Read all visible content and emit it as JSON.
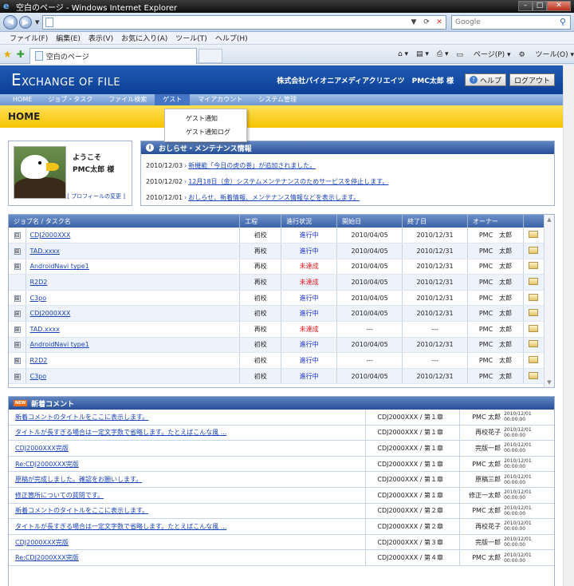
{
  "browser": {
    "title": "空白のページ - Windows Internet Explorer",
    "url": "",
    "search_placeholder": "Google",
    "menu": [
      "ファイル(F)",
      "編集(E)",
      "表示(V)",
      "お気に入り(A)",
      "ツール(T)",
      "ヘルプ(H)"
    ],
    "tab_label": "空白のページ",
    "commands": {
      "page": "ページ(P)",
      "tools": "ツール(O)"
    }
  },
  "app": {
    "logo_first": "E",
    "logo_rest": "XCHANGE OF FILE",
    "company": "株式会社パイオニアメディアクリエイツ　PMC太郎 様",
    "help_label": "ヘルプ",
    "logout_label": "ログアウト",
    "nav": [
      "HOME",
      "ジョブ・タスク",
      "ファイル検索",
      "ゲスト",
      "マイアカウント",
      "システム管理"
    ],
    "guest_menu": [
      "ゲスト通知",
      "ゲスト通知ログ"
    ],
    "page_title": "HOME"
  },
  "profile": {
    "greeting": "ようこそ",
    "name": "PMC太郎 様",
    "change_link": "[ プロフィールの変更 ]"
  },
  "news": {
    "title": "おしらせ・メンテナンス情報",
    "items": [
      {
        "date": "2010/12/03",
        "text": "新機能「今日の虎の巻」が追加されました。"
      },
      {
        "date": "2010/12/02",
        "text": "12月18日（金）システムメンテナンスのためサービスを停止します。"
      },
      {
        "date": "2010/12/01",
        "text": "おしらせ、新着情報、メンテナンス情報などを表示します。"
      }
    ]
  },
  "jobs": {
    "headers": [
      "ジョブ名 / タスク名",
      "工程",
      "進行状況",
      "開始日",
      "終了日",
      "オーナー"
    ],
    "rows": [
      {
        "exp": "⊟",
        "name": "CDJ2000XXX",
        "step": "初校",
        "status": "進行中",
        "state": "active",
        "start": "2010/04/05",
        "end": "2010/12/31",
        "owner": "PMC　太郎"
      },
      {
        "exp": "⊞",
        "name": "TAD.xxxx",
        "step": "再校",
        "status": "進行中",
        "state": "active",
        "start": "2010/04/05",
        "end": "2010/12/31",
        "owner": "PMC　太郎"
      },
      {
        "exp": "⊞",
        "name": "AndroidNavi type1",
        "step": "再校",
        "status": "未達成",
        "state": "pending",
        "start": "2010/04/05",
        "end": "2010/12/31",
        "owner": "PMC　太郎"
      },
      {
        "exp": "",
        "name": "R2D2",
        "step": "再校",
        "status": "未達成",
        "state": "pending",
        "start": "2010/04/05",
        "end": "2010/12/31",
        "owner": "PMC　太郎"
      },
      {
        "exp": "⊞",
        "name": "C3po",
        "step": "初校",
        "status": "進行中",
        "state": "active",
        "start": "2010/04/05",
        "end": "2010/12/31",
        "owner": "PMC　太郎"
      },
      {
        "exp": "⊞",
        "name": "CDJ2000XXX",
        "step": "初校",
        "status": "進行中",
        "state": "active",
        "start": "2010/04/05",
        "end": "2010/12/31",
        "owner": "PMC　太郎"
      },
      {
        "exp": "⊞",
        "name": "TAD.xxxx",
        "step": "再校",
        "status": "未達成",
        "state": "pending",
        "start": "---",
        "end": "---",
        "owner": "PMC　太郎"
      },
      {
        "exp": "⊞",
        "name": "AndroidNavi type1",
        "step": "初校",
        "status": "進行中",
        "state": "active",
        "start": "2010/04/05",
        "end": "2010/12/31",
        "owner": "PMC　太郎"
      },
      {
        "exp": "⊞",
        "name": "R2D2",
        "step": "初校",
        "status": "進行中",
        "state": "active",
        "start": "---",
        "end": "---",
        "owner": "PMC　太郎"
      },
      {
        "exp": "⊞",
        "name": "C3po",
        "step": "初校",
        "status": "進行中",
        "state": "active",
        "start": "2010/04/05",
        "end": "2010/12/31",
        "owner": "PMC　太郎"
      }
    ]
  },
  "comments": {
    "title": "新着コメント",
    "badge": "NEW",
    "rows": [
      {
        "title": "新着コメントのタイトルをここに表示します。",
        "job": "CDJ2000XXX / 第１章",
        "user": "PMC 太郎",
        "date": "2010/12/01 00:00:00"
      },
      {
        "title": "タイトルが長すぎる場合は一定文字数で省略します。たとえばこんな風 ...",
        "job": "CDJ2000XXX / 第１章",
        "user": "再校花子",
        "date": "2010/12/01 00:00:00"
      },
      {
        "title": "CDJ2000XXX完版",
        "job": "CDJ2000XXX / 第１章",
        "user": "完版一郎",
        "date": "2010/12/01 00:00:00"
      },
      {
        "title": "Re:CDJ2000XXX完版",
        "job": "CDJ2000XXX / 第１章",
        "user": "PMC 太郎",
        "date": "2010/12/01 00:00:00"
      },
      {
        "title": "原稿が完成しました。確認をお願いします。",
        "job": "CDJ2000XXX / 第１章",
        "user": "原稿三郎",
        "date": "2010/12/01 00:00:00"
      },
      {
        "title": "修正箇所についての質問です。",
        "job": "CDJ2000XXX / 第１章",
        "user": "修正一太郎",
        "date": "2010/12/01 00:00:00"
      },
      {
        "title": "新着コメントのタイトルをここに表示します。",
        "job": "CDJ2000XXX / 第２章",
        "user": "PMC 太郎",
        "date": "2010/12/01 00:00:00"
      },
      {
        "title": "タイトルが長すぎる場合は一定文字数で省略します。たとえばこんな風 ...",
        "job": "CDJ2000XXX / 第２章",
        "user": "再校花子",
        "date": "2010/12/01 00:00:00"
      },
      {
        "title": "CDJ2000XXX完版",
        "job": "CDJ2000XXX / 第３章",
        "user": "完版一郎",
        "date": "2010/12/01 00:00:00"
      },
      {
        "title": "Re:CDJ2000XXX完版",
        "job": "CDJ2000XXX / 第４章",
        "user": "PMC 太郎",
        "date": "2010/12/01 00:00:00"
      }
    ]
  },
  "colors": {
    "header_blue": "#1f5bb5",
    "home_yellow": "#f5c400",
    "status_active": "#1d2fd8",
    "status_pending": "#e0171d"
  }
}
